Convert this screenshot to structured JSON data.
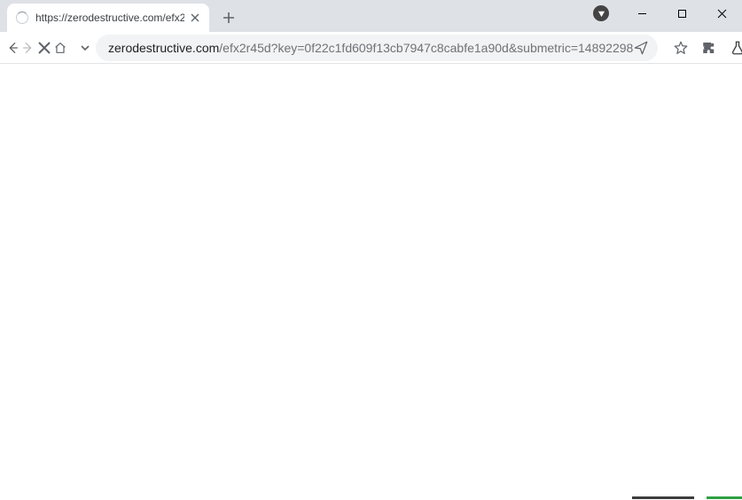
{
  "tab": {
    "title": "https://zerodestructive.com/efx2"
  },
  "address": {
    "domain": "zerodestructive.com",
    "path": "/efx2r45d?key=0f22c1fd609f13cb7947c8cabfe1a90d&submetric=14892298"
  }
}
